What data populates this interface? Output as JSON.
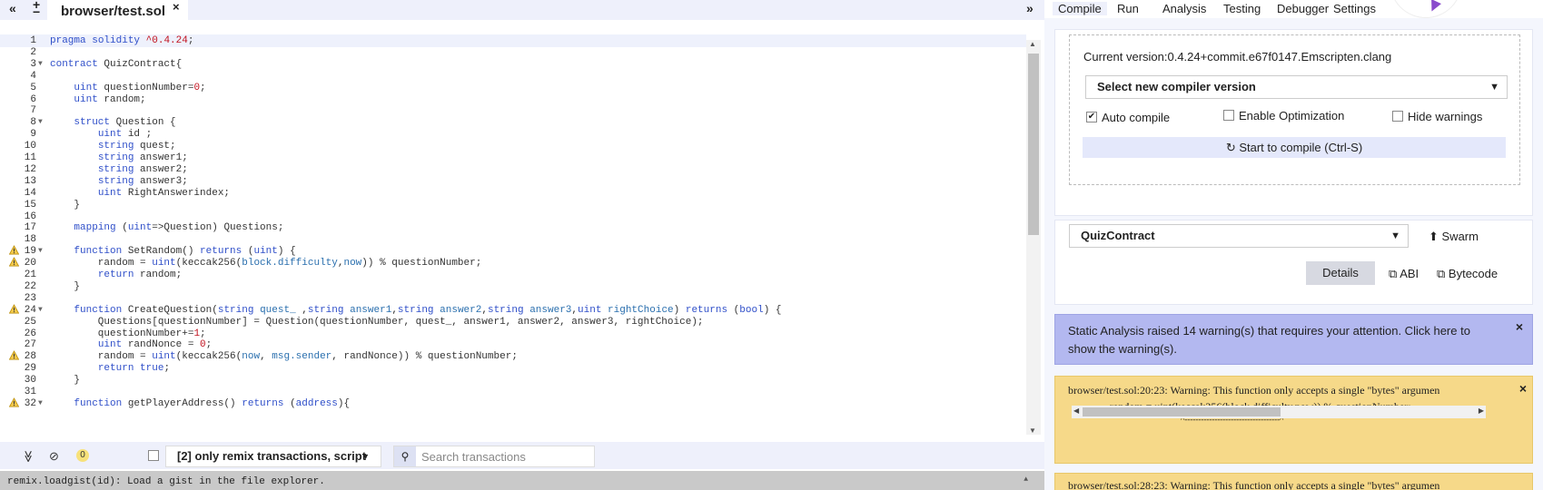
{
  "header": {
    "collapse_left_icon": "«",
    "plus_icon": "+",
    "minus_icon": "−",
    "active_tab": "browser/test.sol",
    "close_icon": "×",
    "expand_right_icon": "»"
  },
  "editor": {
    "lines": [
      {
        "n": "1",
        "html": "<span class=\"k\">pragma</span> <span class=\"k\">solidity</span> <span class=\"n\">^0.4.24</span>;",
        "fold": false,
        "warn": false,
        "active": true
      },
      {
        "n": "2",
        "html": "",
        "fold": false,
        "warn": false
      },
      {
        "n": "3",
        "html": "<span class=\"k\">contract</span> QuizContract{",
        "fold": true,
        "warn": false
      },
      {
        "n": "4",
        "html": "",
        "fold": false,
        "warn": false
      },
      {
        "n": "5",
        "html": "    <span class=\"k\">uint</span> questionNumber=<span class=\"n\">0</span>;",
        "fold": false,
        "warn": false
      },
      {
        "n": "6",
        "html": "    <span class=\"k\">uint</span> random;",
        "fold": false,
        "warn": false
      },
      {
        "n": "7",
        "html": "",
        "fold": false,
        "warn": false
      },
      {
        "n": "8",
        "html": "    <span class=\"k\">struct</span> Question {",
        "fold": true,
        "warn": false
      },
      {
        "n": "9",
        "html": "        <span class=\"k\">uint</span> id ;",
        "fold": false,
        "warn": false
      },
      {
        "n": "10",
        "html": "        <span class=\"k\">string</span> quest;",
        "fold": false,
        "warn": false
      },
      {
        "n": "11",
        "html": "        <span class=\"k\">string</span> answer1;",
        "fold": false,
        "warn": false
      },
      {
        "n": "12",
        "html": "        <span class=\"k\">string</span> answer2;",
        "fold": false,
        "warn": false
      },
      {
        "n": "13",
        "html": "        <span class=\"k\">string</span> answer3;",
        "fold": false,
        "warn": false
      },
      {
        "n": "14",
        "html": "        <span class=\"k\">uint</span> RightAnswerindex;",
        "fold": false,
        "warn": false
      },
      {
        "n": "15",
        "html": "    }",
        "fold": false,
        "warn": false
      },
      {
        "n": "16",
        "html": "",
        "fold": false,
        "warn": false
      },
      {
        "n": "17",
        "html": "    <span class=\"k\">mapping</span> (<span class=\"k\">uint</span>=>Question) Questions;",
        "fold": false,
        "warn": false
      },
      {
        "n": "18",
        "html": "",
        "fold": false,
        "warn": false
      },
      {
        "n": "19",
        "html": "    <span class=\"k\">function</span> SetRandom() <span class=\"k\">returns</span> (<span class=\"k\">uint</span>) {",
        "fold": true,
        "warn": true
      },
      {
        "n": "20",
        "html": "        random = <span class=\"k\">uint</span>(keccak256(<span class=\"s\">block.difficulty</span>,<span class=\"s\">now</span>)) % questionNumber;",
        "fold": false,
        "warn": true
      },
      {
        "n": "21",
        "html": "        <span class=\"k\">return</span> random;",
        "fold": false,
        "warn": false
      },
      {
        "n": "22",
        "html": "    }",
        "fold": false,
        "warn": false
      },
      {
        "n": "23",
        "html": "",
        "fold": false,
        "warn": false
      },
      {
        "n": "24",
        "html": "    <span class=\"k\">function</span> CreateQuestion(<span class=\"k\">string</span> <span class=\"s\">quest_</span> ,<span class=\"k\">string</span> <span class=\"s\">answer1</span>,<span class=\"k\">string</span> <span class=\"s\">answer2</span>,<span class=\"k\">string</span> <span class=\"s\">answer3</span>,<span class=\"k\">uint</span> <span class=\"s\">rightChoice</span>) <span class=\"k\">returns</span> (<span class=\"k\">bool</span>) {",
        "fold": true,
        "warn": true
      },
      {
        "n": "25",
        "html": "        Questions[questionNumber] = Question(questionNumber, quest_, answer1, answer2, answer3, rightChoice);",
        "fold": false,
        "warn": false
      },
      {
        "n": "26",
        "html": "        questionNumber+=<span class=\"n\">1</span>;",
        "fold": false,
        "warn": false
      },
      {
        "n": "27",
        "html": "        <span class=\"k\">uint</span> randNonce = <span class=\"n\">0</span>;",
        "fold": false,
        "warn": false
      },
      {
        "n": "28",
        "html": "        random = <span class=\"k\">uint</span>(keccak256(<span class=\"s\">now</span>, <span class=\"s\">msg.sender</span>, randNonce)) % questionNumber;",
        "fold": false,
        "warn": true
      },
      {
        "n": "29",
        "html": "        <span class=\"k\">return</span> <span class=\"k\">true</span>;",
        "fold": false,
        "warn": false
      },
      {
        "n": "30",
        "html": "    }",
        "fold": false,
        "warn": false
      },
      {
        "n": "31",
        "html": "",
        "fold": false,
        "warn": false
      },
      {
        "n": "32",
        "html": "    <span class=\"k\">function</span> getPlayerAddress() <span class=\"k\">returns</span> (<span class=\"k\">address</span>){",
        "fold": true,
        "warn": true
      }
    ]
  },
  "terminal": {
    "collapse_icon": "≫",
    "clear_icon": "⊘",
    "pending_count": "0",
    "filter_label": "[2] only remix transactions, script",
    "search_placeholder": "Search transactions",
    "console_text": "remix.loadgist(id): Load a gist in the file explorer."
  },
  "right_tabs": [
    "Compile",
    "Run",
    "Analysis",
    "Testing",
    "Debugger",
    "Settings"
  ],
  "compile": {
    "current_version": "Current version:0.4.24+commit.e67f0147.Emscripten.clang",
    "select_version": "Select new compiler version",
    "auto_compile": "Auto compile",
    "auto_compile_checked": true,
    "enable_optimization": "Enable Optimization",
    "hide_warnings": "Hide warnings",
    "compile_button": "Start to compile (Ctrl-S)"
  },
  "contract": {
    "selected": "QuizContract",
    "swarm": "Swarm",
    "details": "Details",
    "abi": "ABI",
    "bytecode": "Bytecode"
  },
  "alerts": {
    "static_analysis": "Static Analysis raised 14 warning(s) that requires your attention. Click here to show the warning(s).",
    "warning_line1": "browser/test.sol:20:23: Warning: This function only accepts a single \"bytes\" argumen",
    "warning_line2": "random = uint(keccak256(block.difficulty,now)) % questionNumber;",
    "warning_line3": "^-----------------------------------^",
    "warning2_line1": "browser/test.sol:28:23: Warning: This function only accepts a single \"bytes\" argumen"
  },
  "colors": {
    "accent": "#2f4fc9",
    "warning_bg": "#f6d989",
    "info_bg": "#b3b8f0",
    "panel_bg": "#f4f6fd"
  }
}
